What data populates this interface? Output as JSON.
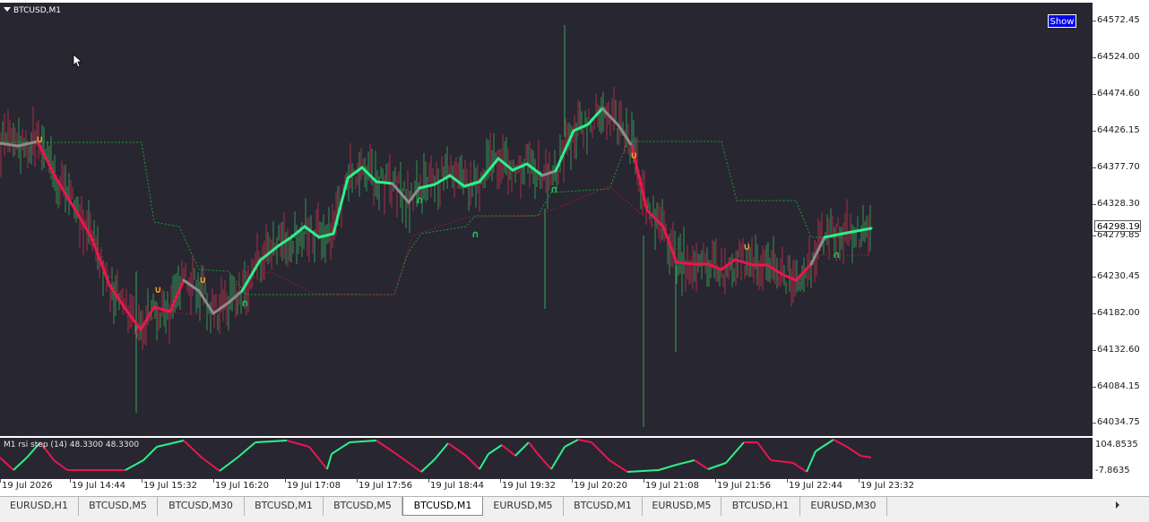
{
  "chart": {
    "symbol_label": "BTCUSD,M1",
    "show_button": "Show",
    "current_price": "64298.19",
    "price_ticks": [
      "64572.45",
      "64524.00",
      "64474.60",
      "64426.15",
      "64377.70",
      "64328.30",
      "64279.85",
      "64230.45",
      "64182.00",
      "64132.60",
      "64084.15",
      "64034.75"
    ],
    "time_ticks": [
      "19 Jul 2026",
      "19 Jul 14:44",
      "19 Jul 15:32",
      "19 Jul 16:20",
      "19 Jul 17:08",
      "19 Jul 17:56",
      "19 Jul 18:44",
      "19 Jul 19:32",
      "19 Jul 20:20",
      "19 Jul 21:08",
      "19 Jul 21:56",
      "19 Jul 22:44",
      "19 Jul 23:32"
    ],
    "colors": {
      "background": "#272631",
      "bull_line": "#2ef08a",
      "bear_line": "#e8174d",
      "neutral_line": "#8c8c8c",
      "arrow_up": "#22c25a",
      "arrow_down": "#f0a020"
    }
  },
  "indicator": {
    "label": "M1 rsi step (14) 48.3300 48.3300",
    "axis_ticks": [
      "104.8535",
      "-7.8635"
    ]
  },
  "tabs": [
    {
      "label": "EURUSD,H1",
      "active": false
    },
    {
      "label": "BTCUSD,M5",
      "active": false
    },
    {
      "label": "BTCUSD,M30",
      "active": false
    },
    {
      "label": "BTCUSD,M1",
      "active": false
    },
    {
      "label": "BTCUSD,M5",
      "active": false
    },
    {
      "label": "BTCUSD,M1",
      "active": true
    },
    {
      "label": "EURUSD,M5",
      "active": false
    },
    {
      "label": "BTCUSD,M1",
      "active": false
    },
    {
      "label": "EURUSD,M5",
      "active": false
    },
    {
      "label": "BTCUSD,H1",
      "active": false
    },
    {
      "label": "EURUSD,M30",
      "active": false
    }
  ],
  "icons": {
    "cursor": "mouse-pointer-icon",
    "dropdown": "triangle-down-icon",
    "tab_nav": "tab-scroll-arrows-icon"
  }
}
